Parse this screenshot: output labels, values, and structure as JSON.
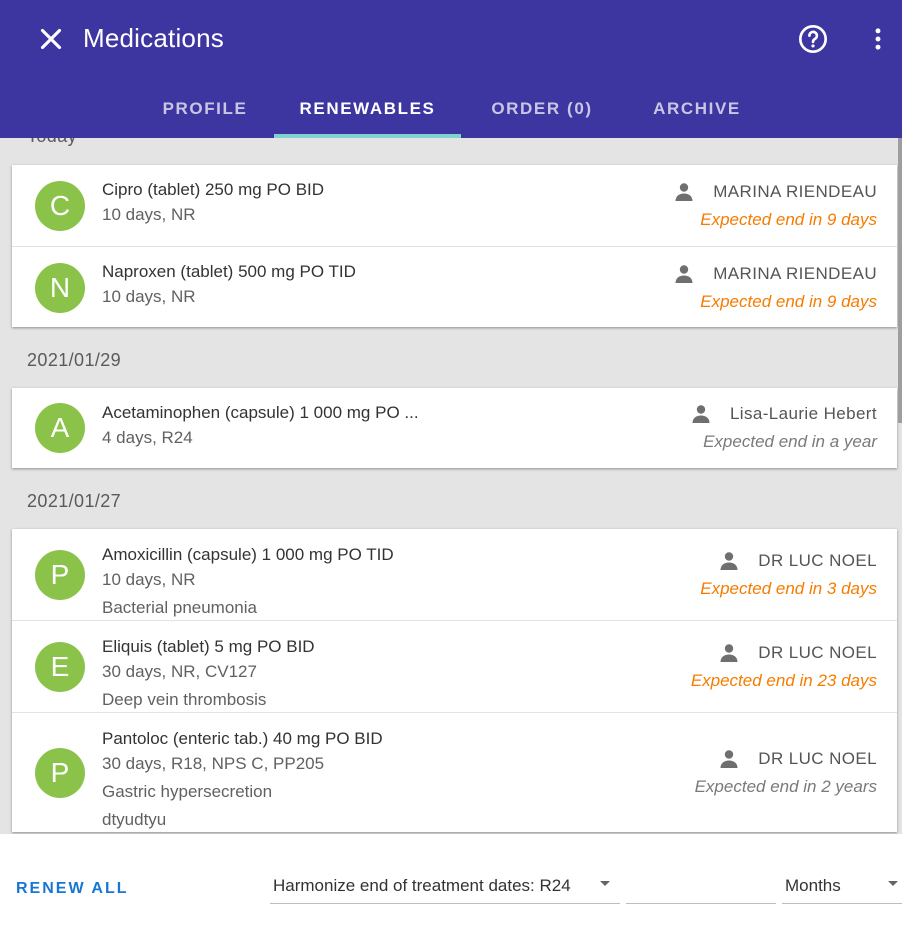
{
  "header": {
    "title": "Medications",
    "bg_color": "#3d35a0",
    "close_icon": "close-icon",
    "help_icon": "help-circle-icon",
    "more_icon": "more-vertical-icon"
  },
  "tabs": [
    {
      "label": "PROFILE",
      "active": false
    },
    {
      "label": "RENEWABLES",
      "active": true
    },
    {
      "label": "ORDER (0)",
      "active": false
    },
    {
      "label": "ARCHIVE",
      "active": false
    }
  ],
  "groups": [
    {
      "date": "Today",
      "items": [
        {
          "initial": "C",
          "lines": [
            "Cipro (tablet) 250 mg PO BID",
            "10 days, NR"
          ],
          "prescriber": "MARINA RIENDEAU",
          "expected": "Expected end in 9 days",
          "warn": true
        },
        {
          "initial": "N",
          "lines": [
            "Naproxen (tablet) 500 mg PO TID",
            "10 days, NR"
          ],
          "prescriber": "MARINA RIENDEAU",
          "expected": "Expected end in 9 days",
          "warn": true
        }
      ]
    },
    {
      "date": "2021/01/29",
      "items": [
        {
          "initial": "A",
          "lines": [
            "Acetaminophen (capsule) 1 000 mg PO ...",
            "4 days, R24"
          ],
          "prescriber": "Lisa-Laurie Hebert",
          "expected": "Expected end in a year",
          "warn": false
        }
      ]
    },
    {
      "date": "2021/01/27",
      "items": [
        {
          "initial": "P",
          "lines": [
            "Amoxicillin (capsule) 1 000 mg PO TID",
            "10 days, NR",
            "Bacterial pneumonia"
          ],
          "prescriber": "DR LUC NOEL",
          "expected": "Expected end in 3 days",
          "warn": true
        },
        {
          "initial": "E",
          "lines": [
            "Eliquis (tablet) 5 mg PO BID",
            "30 days, NR, CV127",
            "Deep vein thrombosis"
          ],
          "prescriber": "DR LUC NOEL",
          "expected": "Expected end in 23 days",
          "warn": true
        },
        {
          "initial": "P",
          "lines": [
            "Pantoloc (enteric tab.) 40 mg PO BID",
            "30 days, R18, NPS C, PP205",
            "Gastric hypersecretion",
            "dtyudtyu"
          ],
          "prescriber": "DR LUC NOEL",
          "expected": "Expected end in 2 years",
          "warn": false
        }
      ]
    }
  ],
  "footer": {
    "renew_all": "RENEW ALL",
    "harmonize_label": "Harmonize end of treatment dates: R24",
    "duration_value": "",
    "unit_value": "Months"
  },
  "colors": {
    "accent": "#1976d2",
    "avatar": "#8bc34a",
    "warning": "#f57c00",
    "tab_indicator": "#7fd3cf"
  }
}
